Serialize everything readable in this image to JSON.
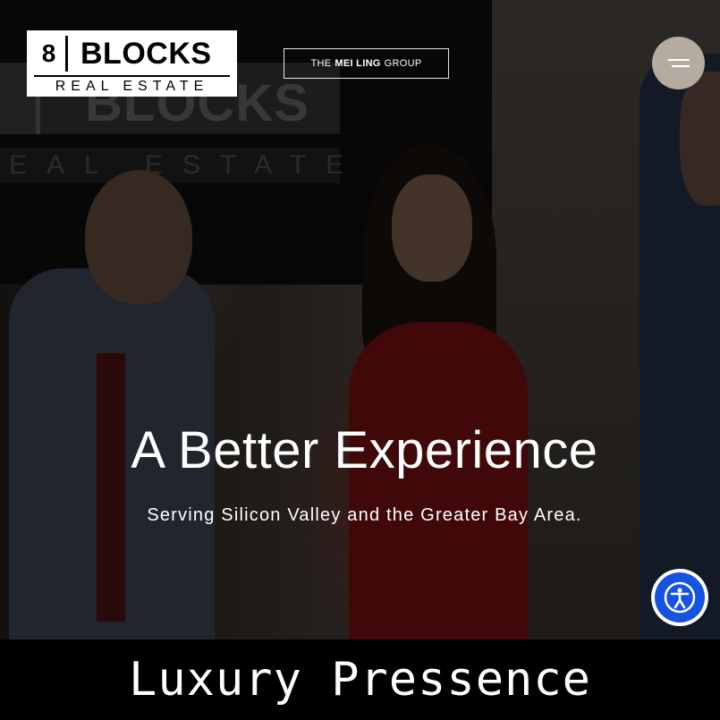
{
  "header": {
    "logo": {
      "number": "8",
      "word": "BLOCKS",
      "subtitle": "REAL ESTATE"
    },
    "team_badge": {
      "prefix": "THE",
      "name": "MEI LING",
      "suffix": "GROUP"
    },
    "menu_icon": "hamburger-menu-icon"
  },
  "hero": {
    "background_logo_word": "BLOCKS",
    "background_logo_sub": "EAL ESTATE",
    "headline": "A Better Experience",
    "subheadline": "Serving Silicon Valley and the Greater Bay Area."
  },
  "accessibility": {
    "icon": "accessibility-person-icon",
    "color": "#1554e0"
  },
  "caption": {
    "text": "Luxury Pressence"
  },
  "colors": {
    "menu_button": "#b5aba1",
    "text": "#ffffff"
  }
}
